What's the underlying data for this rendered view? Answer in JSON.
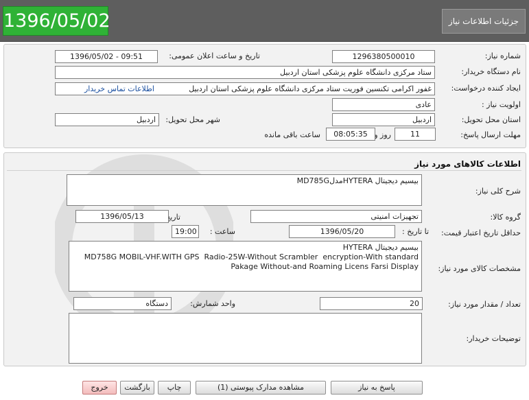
{
  "header": {
    "date": "1396/05/02",
    "title": "جزئیات اطلاعات نیاز"
  },
  "info": {
    "need_number_label": "شماره نیاز:",
    "need_number": "1296380500010",
    "announce_label": "تاریخ و ساعت اعلان عمومی:",
    "announce_value": "1396/05/02 - 09:51",
    "buyer_org_label": "نام دستگاه خریدار:",
    "buyer_org": "ستاد مرکزی دانشگاه علوم پزشکی استان اردبیل",
    "creator_label": "ایجاد کننده درخواست:",
    "creator": "غفور اکرامی تکنسین فوریت ستاد مرکزی دانشگاه علوم پزشکی استان اردبیل",
    "contact_link": "اطلاعات تماس خریدار",
    "priority_label": "اولویت نیاز :",
    "priority": "عادی",
    "province_label": "استان محل تحویل:",
    "province": "اردبیل",
    "city_label": "شهر محل تحویل:",
    "city": "اردبیل",
    "deadline_label": "مهلت ارسال پاسخ:",
    "deadline_days": "11",
    "days_word": "روز و",
    "deadline_time": "08:05:35",
    "remaining_word": "ساعت باقی مانده"
  },
  "goods": {
    "section_title": "اطلاعات کالاهای مورد نیاز",
    "summary_label": "شرح کلی نیاز:",
    "summary": "بیسیم دیجیتال HYTERAمدلMD785G",
    "group_label": "گروه کالا:",
    "group": "تجهیزات امنیتی",
    "need_date_label": "تاریخ نیاز به کالا:",
    "need_date": "1396/05/13",
    "min_price_label": "حداقل تاریخ اعتبار قیمت:",
    "until_date_label": "تا تاریخ :",
    "until_date": "1396/05/20",
    "time_label": "ساعت :",
    "time": "19:00",
    "spec_label": "مشخصات کالای مورد نیاز:",
    "spec_lines": [
      "بیسیم دیجیتال HYTERA",
      "MD758G MOBIL-VHF.WITH GPS  Radio-25W-Without Scrambler  encryption-With standard",
      "Pakage Without-and Roaming Licens Farsi Display"
    ],
    "qty_label": "تعداد / مقدار مورد نیاز:",
    "qty": "20",
    "unit_label": "واحد شمارش:",
    "unit": "دستگاه",
    "buyer_notes_label": "توضیحات خریدار:",
    "buyer_notes": ""
  },
  "buttons": {
    "reply": "پاسخ به نیاز",
    "attachments": "مشاهده مدارک پیوستی (1)",
    "print": "چاپ",
    "back": "بازگشت",
    "exit": "خروج"
  },
  "colors": {
    "header_bg": "#5e5e5e",
    "date_bg": "#2fb236",
    "panel_bg": "#f2f2f2",
    "exit_bg": "#f3bcbc"
  }
}
